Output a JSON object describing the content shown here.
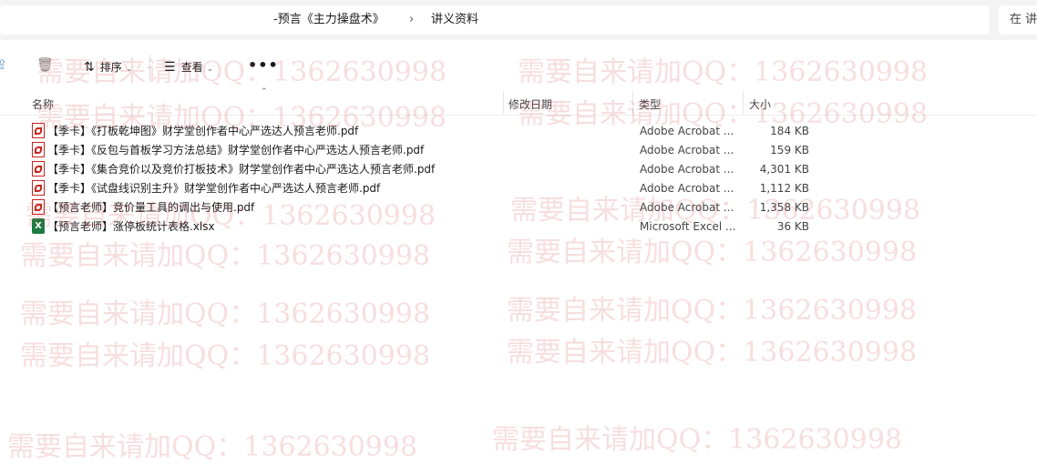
{
  "address": {
    "path_parent": "-预言《主力操盘术》",
    "separator": "›",
    "path_current": "讲义资料",
    "search_placeholder": "在 讲"
  },
  "toolbar": {
    "sort_label": "排序",
    "view_label": "查看",
    "more_label": "•••"
  },
  "columns": {
    "name": "名称",
    "date": "修改日期",
    "type": "类型",
    "size": "大小"
  },
  "files": [
    {
      "name": "【季卡】《打板乾坤图》财学堂创作者中心严选达人预言老师.pdf",
      "type": "Adobe Acrobat ...",
      "size": "184 KB",
      "icon": "pdf-icon"
    },
    {
      "name": "【季卡】《反包与首板学习方法总结》财学堂创作者中心严选达人预言老师.pdf",
      "type": "Adobe Acrobat ...",
      "size": "159 KB",
      "icon": "pdf-icon"
    },
    {
      "name": "【季卡】《集合竞价以及竞价打板技术》财学堂创作者中心严选达人预言老师.pdf",
      "type": "Adobe Acrobat ...",
      "size": "4,301 KB",
      "icon": "pdf-icon"
    },
    {
      "name": "【季卡】《试盘线识别主升》财学堂创作者中心严选达人预言老师.pdf",
      "type": "Adobe Acrobat ...",
      "size": "1,112 KB",
      "icon": "pdf-icon"
    },
    {
      "name": "【预言老师】竞价量工具的调出与使用.pdf",
      "type": "Adobe Acrobat ...",
      "size": "1,358 KB",
      "icon": "pdf-icon"
    },
    {
      "name": "【预言老师】涨停板统计表格.xlsx",
      "type": "Microsoft Excel ...",
      "size": "36 KB",
      "icon": "excel-icon"
    }
  ],
  "watermark": "需要自来请加QQ：1362630998"
}
